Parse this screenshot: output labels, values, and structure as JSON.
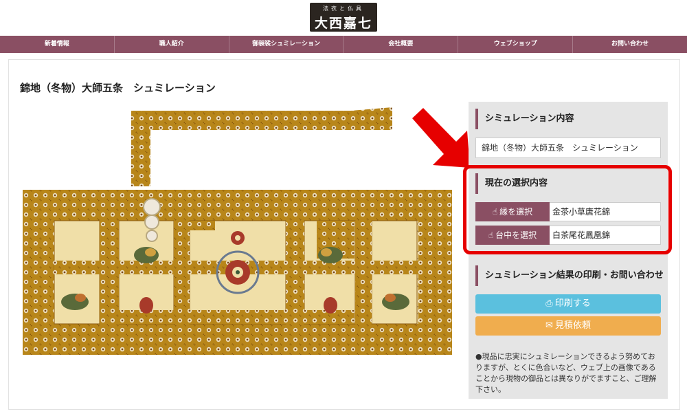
{
  "logo": {
    "small": "法衣と仏具",
    "big": "大西嘉七"
  },
  "nav": [
    "新着情報",
    "職人紹介",
    "御袈裟シュミレーション",
    "会社概要",
    "ウェブショップ",
    "お問い合わせ"
  ],
  "page": {
    "title": "錦地（冬物）大師五条　シュミレーション"
  },
  "sidebar": {
    "content_heading": "シミュレーション内容",
    "content_value": "錦地（冬物）大師五条　シュミレーション",
    "selection_heading": "現在の選択内容",
    "selections": [
      {
        "button": "縁を選択",
        "value": "金茶小草唐花錦"
      },
      {
        "button": "台中を選択",
        "value": "白茶尾花鳳凰錦"
      }
    ],
    "print_heading": "シュミレーション結果の印刷・お問い合わせ",
    "print_button": "印刷する",
    "estimate_button": "見積依頼",
    "note": "●現品に忠実にシュミレーションできるよう努めておりますが、とくに色合いなど、ウェブ上の画像であることから現物の御品とは異なりがでますこと、ご理解下さい。"
  },
  "colors": {
    "accent": "#8a4f63",
    "highlight": "#e60000",
    "print": "#5bc0de",
    "estimate": "#f0ad4e",
    "border_fabric": "#b8861a",
    "center_fabric": "#f0dfa8"
  },
  "icons": {
    "selection": "hand-pointer-icon",
    "print": "print-icon",
    "estimate": "envelope-icon"
  }
}
